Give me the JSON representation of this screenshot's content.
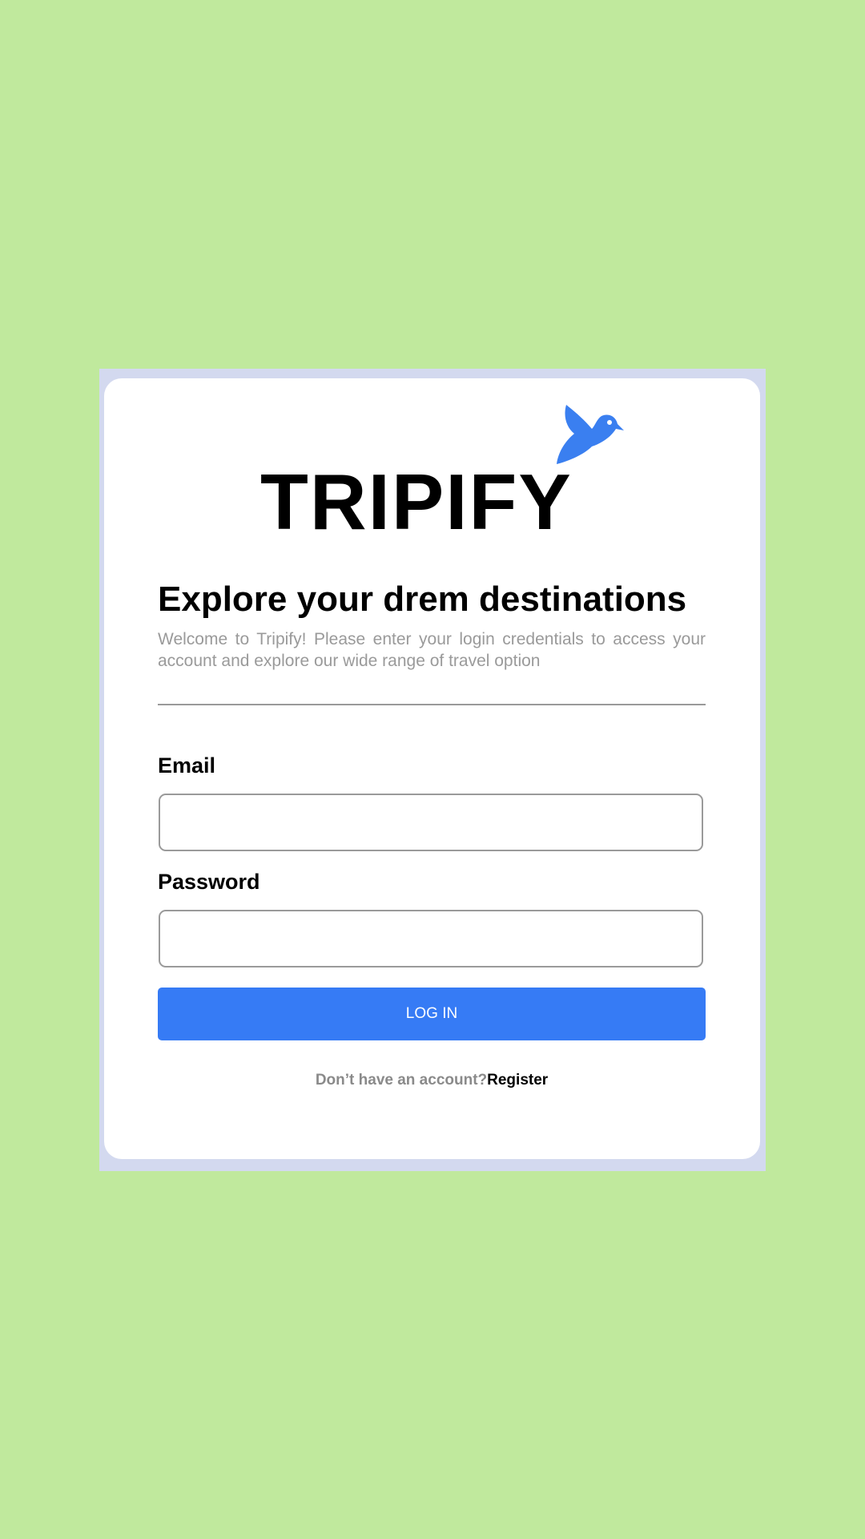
{
  "brand": {
    "name": "TRIPIFY",
    "logo_icon": "bird-icon",
    "icon_color": "#3a7ff0"
  },
  "login": {
    "headline": "Explore your drem destinations",
    "subtitle": "Welcome to Tripify! Please enter your login credentials to access your account and explore our wide range of travel option",
    "email_label": "Email",
    "email_value": "",
    "password_label": "Password",
    "password_value": "",
    "submit_label": "LOG IN",
    "register_prompt": "Don’t have an account?",
    "register_link": "Register"
  },
  "colors": {
    "page_background": "#c0e99d",
    "frame_background": "#d3d9ef",
    "card_background": "#ffffff",
    "button": "#367bf5",
    "muted_text": "#9a9a9a"
  }
}
